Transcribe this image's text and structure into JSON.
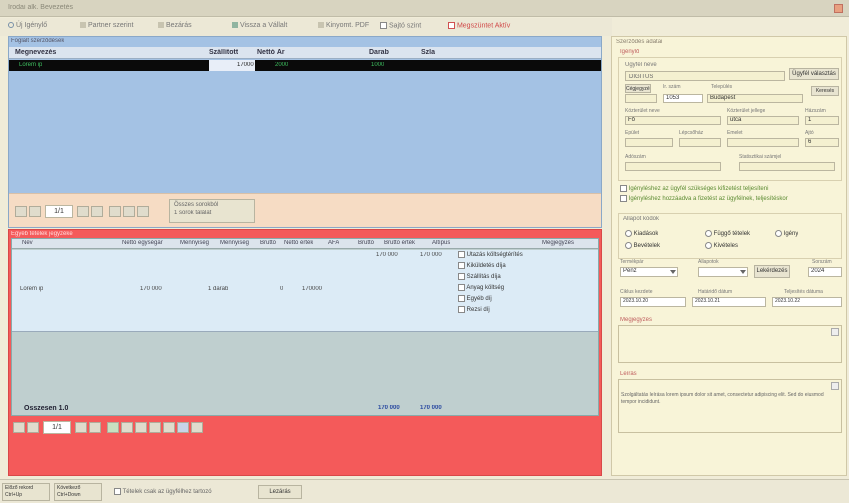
{
  "window": {
    "title": "Irodai alk. Bevezetés"
  },
  "toolbar": {
    "btn_search": "Új Igénylő",
    "btn_filter": "Partner szerint",
    "btn_close": "Bezárás",
    "btn_back": "Vissza a Vállalt",
    "btn_print": "Kinyomt. PDF",
    "chk_sum": "Sajtó szint",
    "chk_red": "Megszüntet Aktív"
  },
  "upper": {
    "caption": "Foglalt szerződések",
    "columns": [
      "Megnevezés",
      "Szállított",
      "Nettó Ár",
      "Darab",
      "Szla"
    ],
    "row": {
      "name": "Lorem ip",
      "qty": "17000",
      "price": "2000",
      "unit": "1000",
      "note": ""
    },
    "pager": {
      "page": "1/1",
      "info_line1": "Összes sorokból",
      "info_line2": "1 sorok találat"
    }
  },
  "lower": {
    "caption": "Egyéb tételek jegyzéke",
    "columns": [
      "Név",
      "Nettó egységár",
      "Mennyiség",
      "Mennyiség",
      "Bruttó",
      "Nettó érték",
      "ÁFA",
      "Bruttó",
      "Bruttó érték",
      "Altípus",
      "Megjegyzés"
    ],
    "row": {
      "name": "Lorem ip",
      "price": "170 000",
      "qty": "1 darab",
      "vat": "0",
      "value": "170000",
      "sum1": "170 000",
      "sum2": "170 000"
    },
    "options": [
      "Utazás költségtérítés",
      "Kiküldetés díja",
      "Szállítás díja",
      "Anyag költség",
      "Egyéb díj",
      "Rezsi díj"
    ],
    "footer_label": "Összesen 1.0",
    "footer_v1": "170 000",
    "footer_v2": "170 000",
    "pager": {
      "page": "1/1"
    }
  },
  "right": {
    "group_title": "Szerződés adatai",
    "section_label": "Igénylő",
    "partner_label": "Ügyfél neve",
    "partner_btn": "Ügyfél választás",
    "partner_code": "DIGITUS",
    "lbl_code": "Cégjegyzék",
    "lbl_zip": "Ir. szám",
    "lbl_city": "Település",
    "city_btn": "Keresés",
    "val_zip": "1053",
    "val_city": "Budapest",
    "lbl_addr": "Közterület neve",
    "lbl_type": "Közterület jellege",
    "lbl_num": "Házszám",
    "val_addr": "Fő",
    "val_type": "utca",
    "val_num": "1",
    "lbl_b1": "Épület",
    "lbl_b2": "Lépcsőház",
    "lbl_b3": "Emelet",
    "lbl_b4": "Ajtó",
    "val_b4": "6",
    "lbl_tax": "Adószám",
    "lbl_reg": "Statisztikai számjel",
    "chk1": "Igényléshez az ügyfél szükséges kifizetést teljesíteni",
    "chk2": "Igényléshez hozzáadva a fizetést az ügyfélnek, teljesítéskor",
    "status_title": "Állapot kódok",
    "radios": [
      "Kiadások",
      "Bevételek",
      "Függő tételek",
      "Kivételes",
      "Igény"
    ],
    "lbl_sel1": "Termékpár",
    "val_sel1": "Pénz",
    "lbl_sel2": "Állapotok",
    "sel_btn": "Lekérdezés",
    "lbl_sel3": "Sorszám",
    "val_sel3": "2024",
    "lbl_d1": "Ciklus kezdete",
    "lbl_d2": "Határidő dátum",
    "lbl_d3": "Teljesítés dátuma",
    "val_d1": "2023.10.20",
    "val_d2": "2023.10.21",
    "val_d3": "2023.10.22",
    "notes1_label": "Megjegyzés",
    "notes2_label": "Leírás",
    "notes2_text": "Szolgáltatás leírása lorem ipsum dolor sit amet, consectetur adipiscing elit. Sed do eiusmod tempor incididunt."
  },
  "status": {
    "btn1_line1": "Előző rekord",
    "btn1_line2": "Ctrl+Up",
    "btn2_line1": "Következő",
    "btn2_line2": "Ctrl+Down",
    "chk": "Tételek csak az ügyfélhez tartozó",
    "btn3": "Lezárás"
  }
}
